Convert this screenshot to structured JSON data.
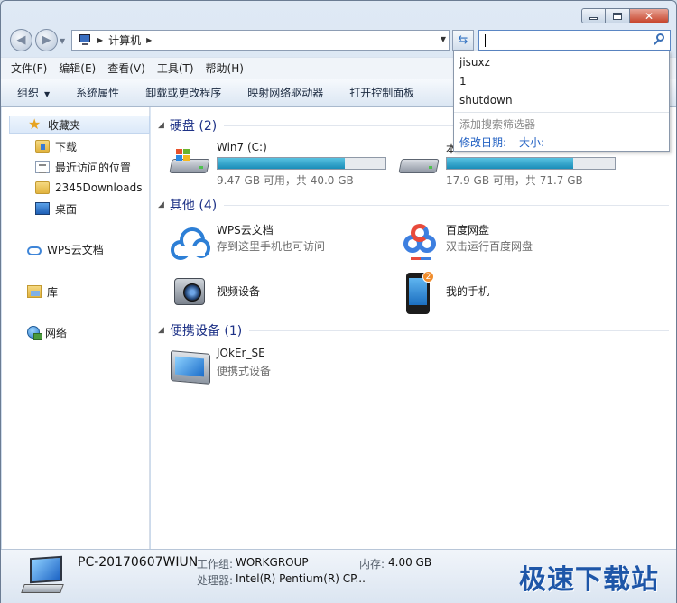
{
  "window": {
    "title_buttons": {
      "minimize": "minimize",
      "maximize": "maximize",
      "close": "close"
    }
  },
  "address": {
    "crumb": "计算机",
    "search_value": ""
  },
  "search_dropdown": {
    "suggestions": [
      "jisuxz",
      "1",
      "shutdown"
    ],
    "filter_label": "添加搜索筛选器",
    "filters": [
      "修改日期:",
      "大小:"
    ]
  },
  "menu": [
    "文件(F)",
    "编辑(E)",
    "查看(V)",
    "工具(T)",
    "帮助(H)"
  ],
  "toolbar": [
    "组织",
    "系统属性",
    "卸载或更改程序",
    "映射网络驱动器",
    "打开控制面板"
  ],
  "sidebar": {
    "favorites": "收藏夹",
    "favorite_items": [
      "下载",
      "最近访问的位置",
      "2345Downloads",
      "桌面"
    ],
    "wps": "WPS云文档",
    "library": "库",
    "network": "网络"
  },
  "groups": {
    "disks": {
      "title": "硬盘 (2)",
      "items": [
        {
          "name": "Win7 (C:)",
          "free": "9.47 GB 可用，共 40.0 GB",
          "used_fraction": 0.76
        },
        {
          "name": "本",
          "free": "17.9 GB 可用，共 71.7 GB",
          "used_fraction": 0.75
        }
      ]
    },
    "other": {
      "title": "其他 (4)",
      "items": [
        {
          "name": "WPS云文档",
          "sub": "存到这里手机也可访问"
        },
        {
          "name": "百度网盘",
          "sub": "双击运行百度网盘"
        },
        {
          "name": "视频设备",
          "sub": ""
        },
        {
          "name": "我的手机",
          "sub": "",
          "badge": "2"
        }
      ]
    },
    "portable": {
      "title": "便携设备 (1)",
      "items": [
        {
          "name": "JOkEr_SE",
          "sub": "便携式设备"
        }
      ]
    }
  },
  "details": {
    "computer_name": "PC-20170607WIUN",
    "workgroup_label": "工作组:",
    "workgroup": "WORKGROUP",
    "memory_label": "内存:",
    "memory": "4.00 GB",
    "cpu_label": "处理器:",
    "cpu": "Intel(R) Pentium(R) CP..."
  },
  "watermark": "极速下载站",
  "colors": {
    "accent": "#1e3287",
    "link": "#1f5fc2",
    "bar_fill": "#26a0c9"
  }
}
